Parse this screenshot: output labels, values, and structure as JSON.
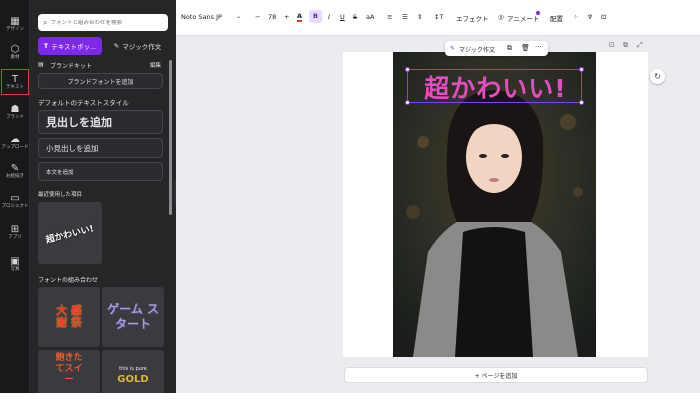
{
  "rail": {
    "items": [
      {
        "icon": "▦",
        "label": "デザイン",
        "active": false
      },
      {
        "icon": "⬡",
        "label": "素材",
        "active": false
      },
      {
        "icon": "T",
        "label": "テキスト",
        "active": true
      },
      {
        "icon": "☗",
        "label": "ブランド",
        "active": false
      },
      {
        "icon": "☁",
        "label": "アップロード",
        "active": false
      },
      {
        "icon": "✎",
        "label": "お絵描き",
        "active": false
      },
      {
        "icon": "▭",
        "label": "プロジェクト",
        "active": false
      },
      {
        "icon": "⊞",
        "label": "アプリ",
        "active": false
      },
      {
        "icon": "▣",
        "label": "写真",
        "active": false
      }
    ]
  },
  "panel": {
    "search_placeholder": "フォントと組み合わせを検索",
    "text_button": "テキストボッ...",
    "magic_button": "マジック作文",
    "brand_kit": {
      "title": "ブランドキット",
      "edit": "編集",
      "add_font": "ブランドフォントを追加"
    },
    "default_styles_title": "デフォルトのテキストスタイル",
    "add_heading": "見出しを追加",
    "add_subheading": "小見出しを追加",
    "add_body": "本文を追加",
    "recent_title": "最近使用した項目",
    "recent_item": "超かわいい!",
    "combos_title": "フォントの組み合わせ",
    "combos": [
      {
        "text": "大 感 謝 祭",
        "color": "#e8362c"
      },
      {
        "text": "ゲーム スタート",
        "color": "#a79ddb"
      },
      {
        "text": "飽きたてスイー",
        "color": "#e85b2c"
      },
      {
        "small": "this is pure",
        "big": "GOLD",
        "color": "#e0b33a"
      }
    ]
  },
  "toolbar": {
    "font": "Noto Sans JP",
    "size": "78",
    "minus": "−",
    "plus": "+",
    "bold": "B",
    "italic": "I",
    "underline": "U",
    "strike": "S",
    "case": "aA",
    "effects": "エフェクト",
    "animate": "アニメート",
    "position": "配置"
  },
  "canvas": {
    "heading": "超かわいい!",
    "magic_write": "マジック作文",
    "add_page": "+ ページを追加"
  },
  "colors": {
    "accent": "#7d2ae8",
    "heading_text": "#e44dc0",
    "rail_bg": "#18191b",
    "panel_bg": "#252627",
    "active_outline": "#e23a2e"
  }
}
